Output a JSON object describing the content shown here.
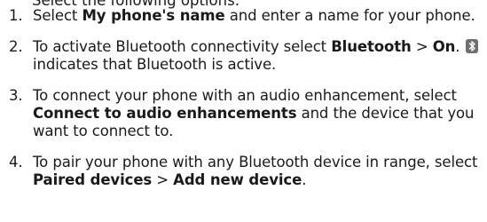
{
  "cut_line": "Select  the following options:",
  "steps": [
    {
      "num": "1.",
      "pre": "Select ",
      "bold": "My phone's name",
      "post": " and enter a name for your phone."
    },
    {
      "num": "2.",
      "pre": "To activate Bluetooth connectivity select ",
      "bold1": "Bluetooth",
      "sep": " > ",
      "bold2": "On",
      "mid": ".",
      "post": " indicates that Bluetooth is active."
    },
    {
      "num": "3.",
      "pre": "To connect your phone with an audio enhancement, select ",
      "bold": "Connect to audio enhancements",
      "post": " and the device that you want to connect to."
    },
    {
      "num": "4.",
      "pre": "To pair your phone with any Bluetooth device in range, select ",
      "bold1": "Paired devices",
      "sep": " > ",
      "bold2": "Add new device",
      "post": "."
    }
  ],
  "icons": {
    "bluetooth_active": "bluetooth-icon"
  }
}
